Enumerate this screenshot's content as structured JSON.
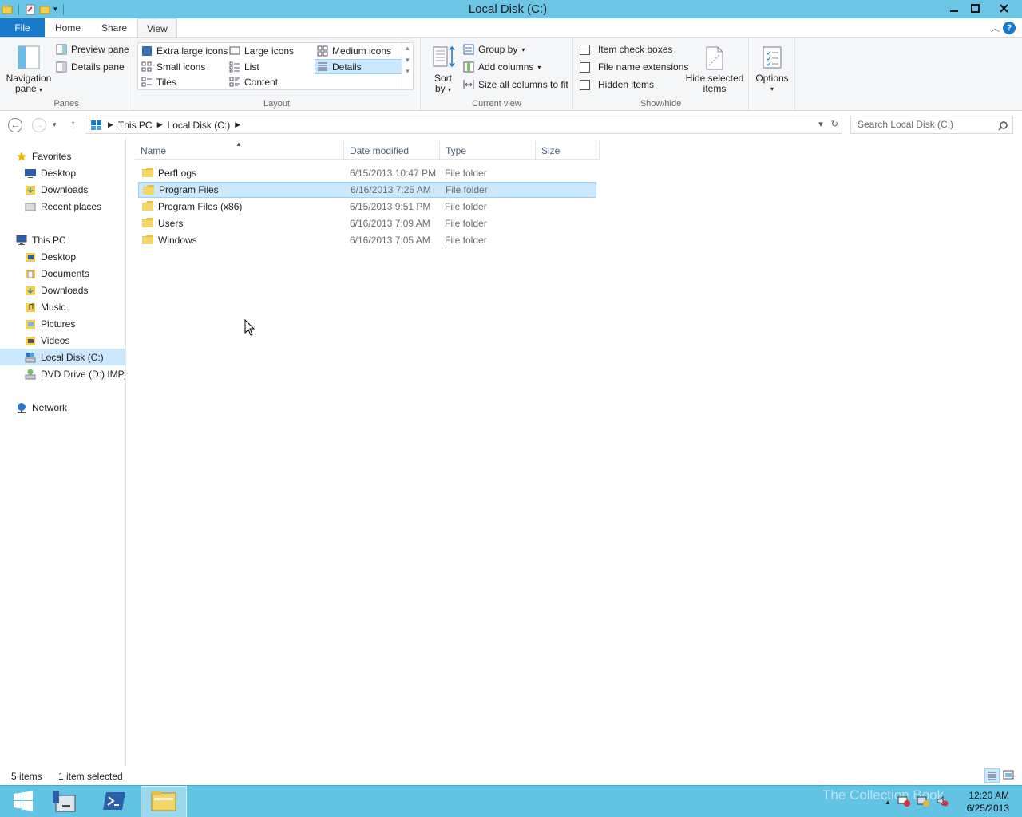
{
  "window": {
    "title": "Local Disk (C:)"
  },
  "tabs": {
    "file": "File",
    "home": "Home",
    "share": "Share",
    "view": "View"
  },
  "ribbon": {
    "panes": {
      "navigation_pane_line1": "Navigation",
      "navigation_pane_line2": "pane",
      "preview_pane": "Preview pane",
      "details_pane": "Details pane",
      "label": "Panes"
    },
    "layout": {
      "extra_large": "Extra large icons",
      "large": "Large icons",
      "medium": "Medium icons",
      "small": "Small icons",
      "list": "List",
      "details": "Details",
      "tiles": "Tiles",
      "content": "Content",
      "label": "Layout",
      "selected": "Details"
    },
    "current_view": {
      "sort_line1": "Sort",
      "sort_line2": "by",
      "group_by": "Group by",
      "add_columns": "Add columns",
      "size_all": "Size all columns to fit",
      "label": "Current view"
    },
    "show_hide": {
      "item_check_boxes": "Item check boxes",
      "file_name_extensions": "File name extensions",
      "hidden_items": "Hidden items",
      "hide_selected_line1": "Hide selected",
      "hide_selected_line2": "items",
      "label": "Show/hide"
    },
    "options": "Options"
  },
  "address": {
    "crumbs": [
      "This PC",
      "Local Disk (C:)"
    ],
    "search_placeholder": "Search Local Disk (C:)"
  },
  "nav": {
    "favorites": "Favorites",
    "fav_items": [
      "Desktop",
      "Downloads",
      "Recent places"
    ],
    "this_pc": "This PC",
    "pc_items": [
      "Desktop",
      "Documents",
      "Downloads",
      "Music",
      "Pictures",
      "Videos",
      "Local Disk (C:)",
      "DVD Drive (D:) IMP_S"
    ],
    "network": "Network",
    "selected": "Local Disk (C:)"
  },
  "columns": {
    "name": "Name",
    "date": "Date modified",
    "type": "Type",
    "size": "Size"
  },
  "files": [
    {
      "name": "PerfLogs",
      "date": "6/15/2013 10:47 PM",
      "type": "File folder"
    },
    {
      "name": "Program Files",
      "date": "6/16/2013 7:25 AM",
      "type": "File folder"
    },
    {
      "name": "Program Files (x86)",
      "date": "6/15/2013 9:51 PM",
      "type": "File folder"
    },
    {
      "name": "Users",
      "date": "6/16/2013 7:09 AM",
      "type": "File folder"
    },
    {
      "name": "Windows",
      "date": "6/16/2013 7:05 AM",
      "type": "File folder"
    }
  ],
  "selected_file": "Program Files",
  "status": {
    "count": "5 items",
    "selection": "1 item selected"
  },
  "taskbar": {
    "time": "12:20 AM",
    "date": "6/25/2013",
    "watermark": "The Collection Book"
  },
  "colors": {
    "titlebar": "#6bc6e6",
    "file_tab": "#1979ca",
    "selection": "#cce8ff",
    "taskbar": "#63c3e4"
  },
  "icons": [
    "folder-icon",
    "star-icon",
    "desktop-icon",
    "computer-icon",
    "drive-icon",
    "dvd-icon",
    "network-icon",
    "search-icon",
    "windows-logo-icon",
    "powershell-icon",
    "server-manager-icon"
  ]
}
